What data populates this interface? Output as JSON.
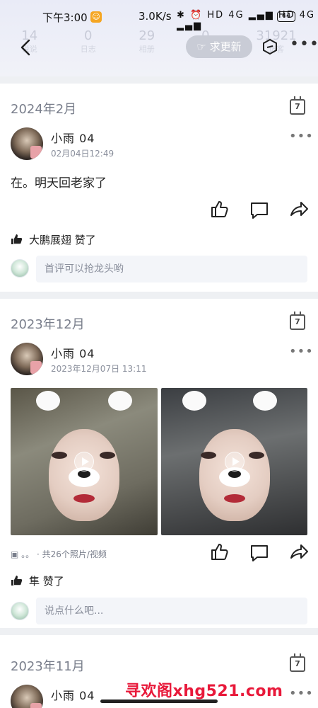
{
  "status_bar": {
    "time": "下午3:00",
    "network_speed": "3.0K/s",
    "indicators": "✱ ⏰ HD 4G ▂▄▆ HD 4G ▂▄▆",
    "battery": "44"
  },
  "ghost_stats": [
    {
      "value": "14",
      "label": "说说"
    },
    {
      "value": "0",
      "label": "日志"
    },
    {
      "value": "29",
      "label": "相册"
    },
    {
      "value": "0",
      "label": "留言"
    },
    {
      "value": "31921",
      "label": "访客"
    }
  ],
  "header": {
    "request_update_label": "求更新"
  },
  "posts": [
    {
      "month": "2024年2月",
      "calendar_day": "7",
      "username": "小雨  04",
      "date": "02月04日12:49",
      "text": "在。明天回老家了",
      "likes": "大鹏展翅 赞了",
      "comment_placeholder": "首评可以抢龙头哟"
    },
    {
      "month": "2023年12月",
      "calendar_day": "7",
      "username": "小雨  04",
      "date": "2023年12月07日 13:11",
      "photo_meta": "。。 · 共26个照片/视频",
      "likes": "隼 赞了",
      "comment_placeholder": "说点什么吧..."
    },
    {
      "month": "2023年11月",
      "calendar_day": "7",
      "username": "小雨  04"
    }
  ],
  "watermark": "寻欢阁xhg521.com",
  "colors": {
    "accent_red": "#e8193a",
    "muted_text": "#7a7f8c",
    "button_gray": "#c9ccd6"
  }
}
